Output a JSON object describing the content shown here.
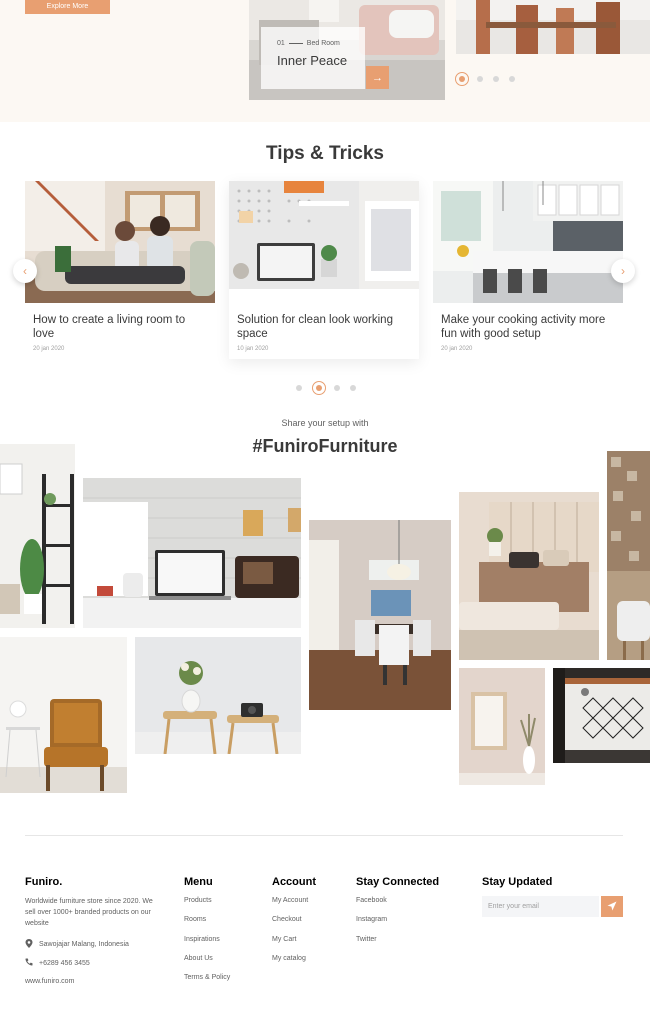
{
  "inspiration": {
    "explore_label": "Explore More",
    "slide_number": "01",
    "slide_room": "Bed Room",
    "slide_title": "Inner Peace",
    "arrow_glyph": "→"
  },
  "tips": {
    "title": "Tips & Tricks",
    "prev_glyph": "‹",
    "next_glyph": "›",
    "cards": [
      {
        "title": "How to create a living room to love",
        "date": "20 jan 2020"
      },
      {
        "title": "Solution for clean look working space",
        "date": "10 jan 2020"
      },
      {
        "title": "Make your cooking activity more fun with good setup",
        "date": "20 jan 2020"
      }
    ]
  },
  "share": {
    "subtitle": "Share your setup with",
    "hashtag": "#FuniroFurniture"
  },
  "footer": {
    "brand": "Funiro.",
    "description": "Worldwide furniture store since 2020. We sell over 1000+ branded products on our website",
    "address": "Sawojajar Malang, Indonesia",
    "phone": "+6289 456 3455",
    "website": "www.funiro.com",
    "menu": {
      "heading": "Menu",
      "items": [
        "Products",
        "Rooms",
        "Inspirations",
        "About Us",
        "Terms & Policy"
      ]
    },
    "account": {
      "heading": "Account",
      "items": [
        "My Account",
        "Checkout",
        "My Cart",
        "My catalog"
      ]
    },
    "connected": {
      "heading": "Stay Connected",
      "items": [
        "Facebook",
        "Instagram",
        "Twitter"
      ]
    },
    "updated": {
      "heading": "Stay Updated",
      "email_placeholder": "Enter your email"
    }
  },
  "colors": {
    "accent": "#e89f71",
    "band": "#fcf8f3",
    "text": "#3a3a3a",
    "muted": "#616161"
  },
  "icons": [
    "arrow-right-icon",
    "chevron-left-icon",
    "chevron-right-icon",
    "location-pin-icon",
    "phone-icon",
    "send-icon"
  ]
}
